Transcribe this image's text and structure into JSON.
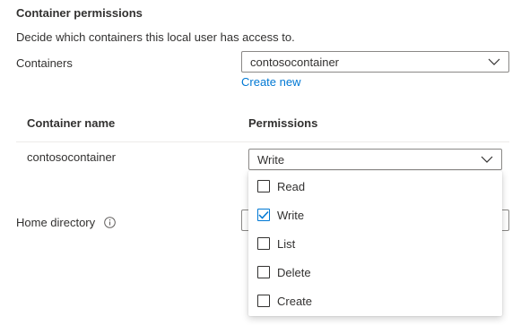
{
  "section": {
    "title": "Container permissions",
    "description": "Decide which containers this local user has access to."
  },
  "containers": {
    "label": "Containers",
    "selected": "contosocontainer",
    "create_new": "Create new"
  },
  "table": {
    "headers": [
      "Container name",
      "Permissions"
    ],
    "rows": [
      {
        "name": "contosocontainer",
        "permission": "Write"
      }
    ]
  },
  "home_directory": {
    "label": "Home directory",
    "value": ""
  },
  "permissions_dropdown": {
    "options": [
      {
        "label": "Read",
        "checked": false
      },
      {
        "label": "Write",
        "checked": true
      },
      {
        "label": "List",
        "checked": false
      },
      {
        "label": "Delete",
        "checked": false
      },
      {
        "label": "Create",
        "checked": false
      }
    ]
  },
  "colors": {
    "accent": "#0078d4",
    "border": "#8a8886",
    "text": "#323130"
  },
  "icons": [
    "chevron-down-icon",
    "info-icon",
    "checkmark-icon"
  ]
}
